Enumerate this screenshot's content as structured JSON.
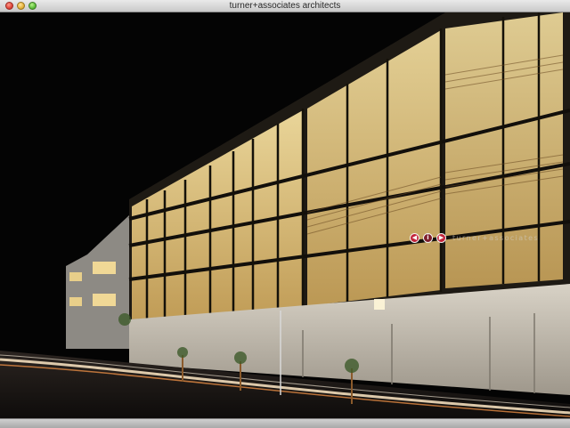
{
  "window": {
    "title": "turner+associates architects"
  },
  "navigation": {
    "prev_icon": "back-arrow-icon",
    "info_icon": "info-icon",
    "next_icon": "forward-arrow-icon",
    "prev_glyph": "◀",
    "info_glyph": "i",
    "next_glyph": "▶",
    "brand": "turner+associates"
  },
  "colors": {
    "accent": "#c3243a",
    "window_glow": "#e8c878",
    "facade_dark": "#1e1a14"
  }
}
